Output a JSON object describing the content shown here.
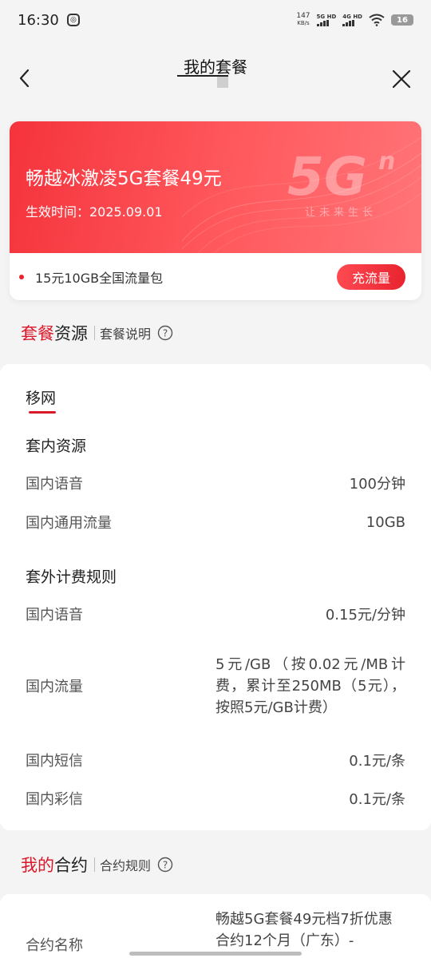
{
  "status_bar": {
    "time": "16:30",
    "net_speed_value": "147",
    "net_speed_unit": "KB/s",
    "sim1": "5G HD",
    "sim2": "4G HD",
    "battery": "16"
  },
  "header": {
    "title": "我的套餐"
  },
  "plan_card": {
    "plan_name": "畅越冰激凌5G套餐49元",
    "effective_label": "生效时间：2025.09.01",
    "logo_text": "5G",
    "logo_sup": "n",
    "logo_slogan": "让未来生长",
    "addon": "15元10GB全国流量包",
    "recharge_button": "充流量"
  },
  "resources_section": {
    "title_red": "套餐",
    "title_black": "资源",
    "link": "套餐说明",
    "tab": "移网",
    "included_title": "套内资源",
    "included": [
      {
        "label": "国内语音",
        "value": "100分钟"
      },
      {
        "label": "国内通用流量",
        "value": "10GB"
      }
    ],
    "overage_title": "套外计费规则",
    "overage": [
      {
        "label": "国内语音",
        "value": "0.15元/分钟"
      },
      {
        "label": "国内流量",
        "value": "5元/GB（按0.02元/MB计费，累计至250MB（5元），按照5元/GB计费）"
      },
      {
        "label": "国内短信",
        "value": "0.1元/条"
      },
      {
        "label": "国内彩信",
        "value": "0.1元/条"
      }
    ]
  },
  "contract_section": {
    "title_red": "我的",
    "title_black": "合约",
    "link": "合约规则",
    "contract_label": "合约名称",
    "contract_value": "畅越5G套餐49元档7折优惠合约12个月（广东）-"
  },
  "colors": {
    "accent": "#d9182a",
    "card_gradient_start": "#f5333c",
    "card_gradient_end": "#ff7478"
  }
}
